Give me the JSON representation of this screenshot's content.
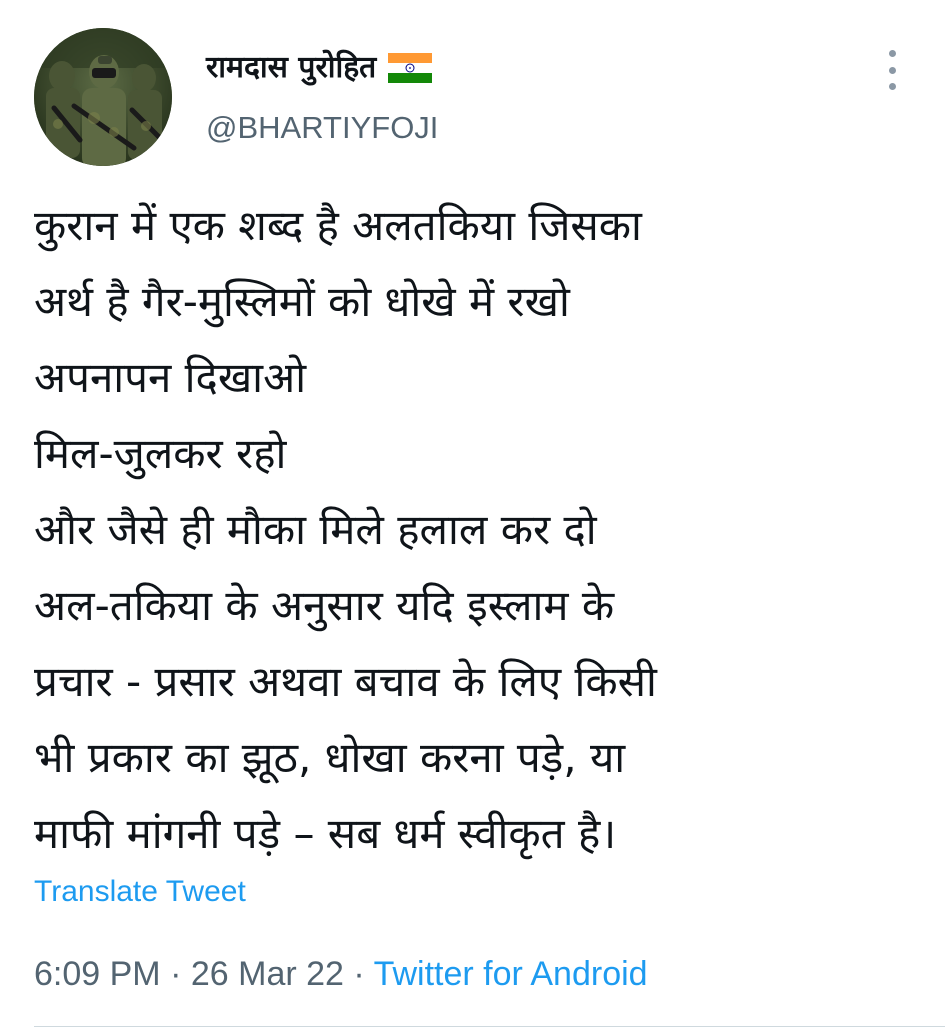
{
  "author": {
    "display_name": "रामदास पुरोहित",
    "flag_icon": "india-flag-icon",
    "handle": "@BHARTIYFOJI"
  },
  "menu": {
    "icon": "more-vertical-icon"
  },
  "tweet": {
    "lines": [
      "कुरान में एक शब्द है अलतकिया जिसका",
      "अर्थ है गैर-मुस्लिमों को धोखे में रखो",
      "अपनापन दिखाओ",
      "मिल-जुलकर रहो",
      "और जैसे ही मौका मिले हलाल कर दो",
      "अल-तकिया के अनुसार यदि इस्लाम के",
      "प्रचार - प्रसार अथवा बचाव के लिए किसी",
      "भी प्रकार का झूठ, धोखा करना पड़े, या",
      "माफी मांगनी पड़े – सब धर्म स्वीकृत है।"
    ],
    "translate_label": "Translate Tweet"
  },
  "meta": {
    "time": "6:09 PM",
    "separator": "·",
    "date": "26 Mar 22",
    "source": "Twitter for Android"
  },
  "colors": {
    "text": "#0f1419",
    "secondary": "#536471",
    "link": "#1d9bf0",
    "divider": "#cfd9de"
  }
}
